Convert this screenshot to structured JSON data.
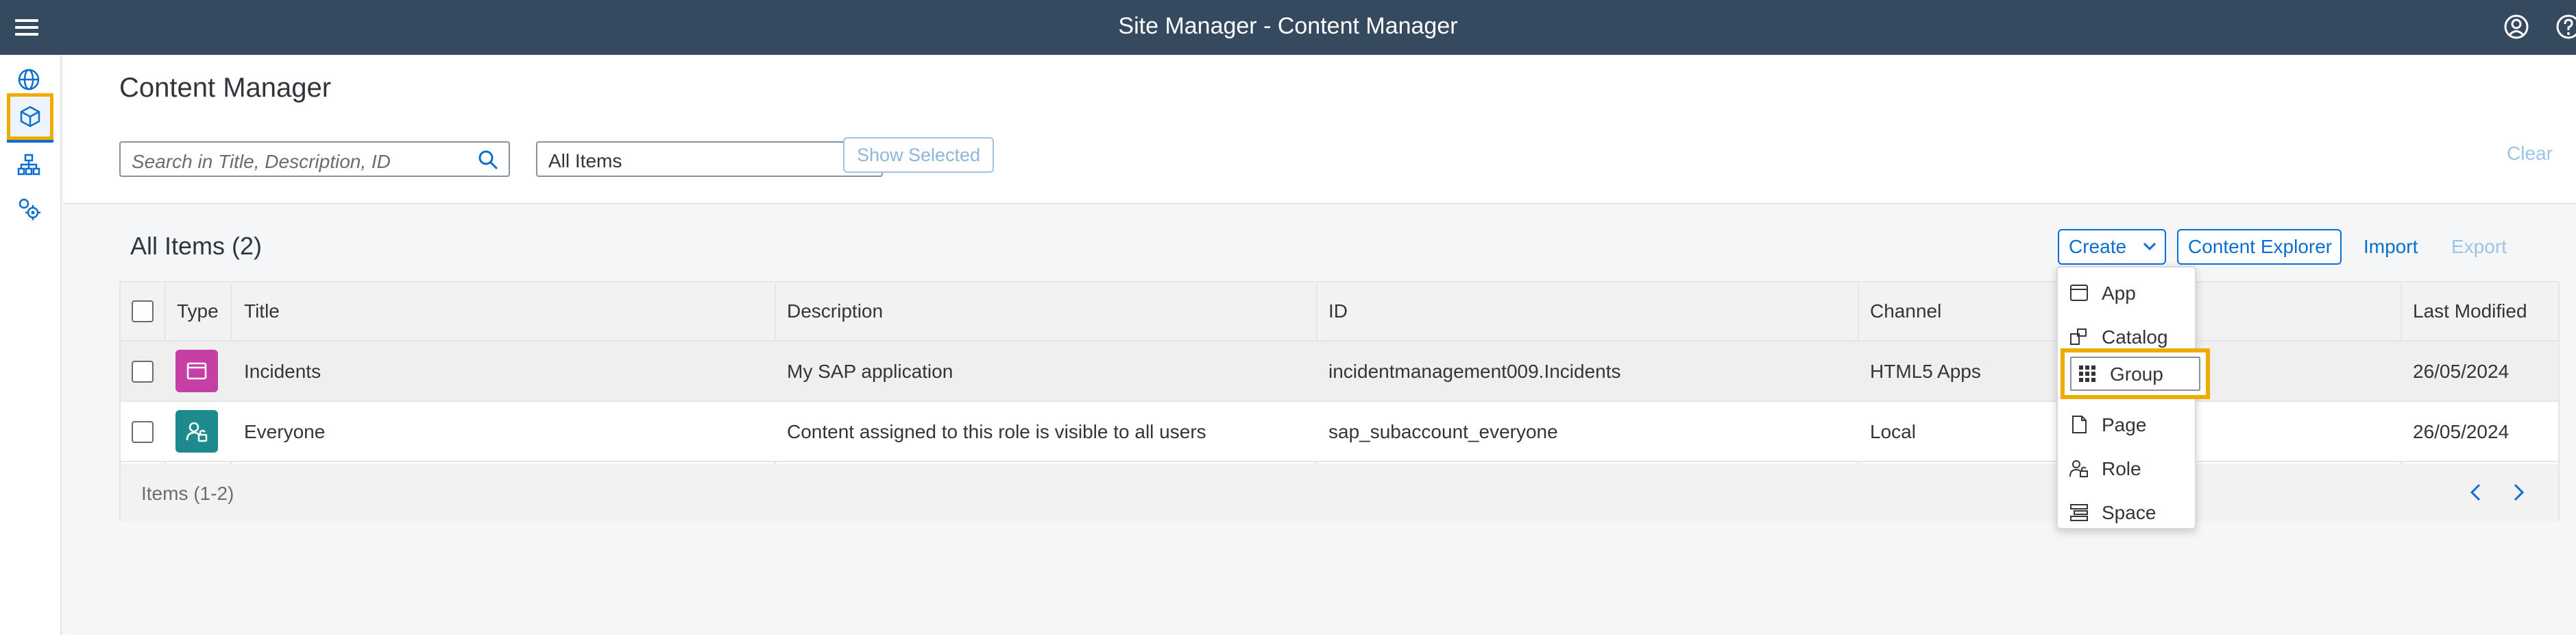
{
  "shell": {
    "title": "Site Manager - Content Manager"
  },
  "sidenav": {
    "items": [
      "globe-icon",
      "cube-icon",
      "hierarchy-icon",
      "settings-icon"
    ],
    "active": 1
  },
  "page": {
    "title": "Content Manager",
    "search_placeholder": "Search in Title, Description, ID",
    "filter_value": "All Items",
    "show_selected": "Show Selected",
    "clear": "Clear"
  },
  "toolbar": {
    "heading": "All Items (2)",
    "create": "Create",
    "content_explorer": "Content Explorer",
    "import": "Import",
    "export": "Export"
  },
  "table": {
    "columns": [
      "Type",
      "Title",
      "Description",
      "ID",
      "Channel",
      "Last Modified"
    ],
    "rows": [
      {
        "type": "app",
        "type_color": "#c53fa4",
        "title": "Incidents",
        "description": "My SAP application",
        "id": "incidentmanagement009.Incidents",
        "channel": "HTML5 Apps",
        "last_modified": "26/05/2024"
      },
      {
        "type": "role",
        "type_color": "#1d8a8e",
        "title": "Everyone",
        "description": "Content assigned to this role is visible to all users",
        "id": "sap_subaccount_everyone",
        "channel": "Local",
        "last_modified": "26/05/2024"
      }
    ],
    "footer": "Items (1-2)"
  },
  "create_menu": {
    "items": [
      {
        "label": "App",
        "icon": "app-window-icon"
      },
      {
        "label": "Catalog",
        "icon": "catalog-icon"
      },
      {
        "label": "Group",
        "icon": "grid-icon"
      },
      {
        "label": "Page",
        "icon": "page-icon"
      },
      {
        "label": "Role",
        "icon": "role-icon"
      },
      {
        "label": "Space",
        "icon": "space-icon"
      }
    ],
    "highlighted": "Group"
  },
  "colors": {
    "shell": "#354a5f",
    "accent": "#0a6ed1",
    "highlight": "#f0ab00"
  }
}
